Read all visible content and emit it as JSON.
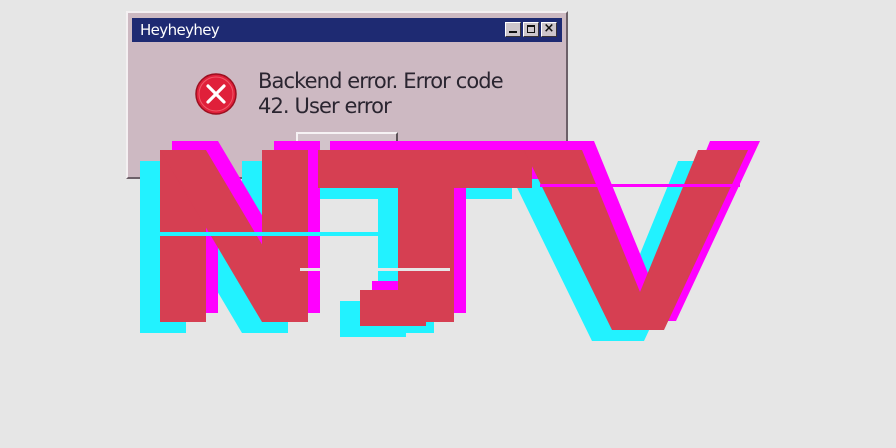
{
  "window": {
    "title": "Heyheyhey",
    "message_line1": "Backend error. Error code",
    "message_line2": "42. User error",
    "error_icon": "error-x-icon",
    "title_buttons": [
      "minimize-icon",
      "maximize-icon",
      "close-icon"
    ],
    "colors": {
      "titlebar": "#1e2a72",
      "window_bg": "#cdb9c2",
      "error_red": "#e0203a"
    }
  },
  "logo": {
    "colors": {
      "main": "#d63f52",
      "magenta": "#ff00ff",
      "cyan": "#22f2ff"
    }
  },
  "page": {
    "background": "#e6e6e6"
  }
}
